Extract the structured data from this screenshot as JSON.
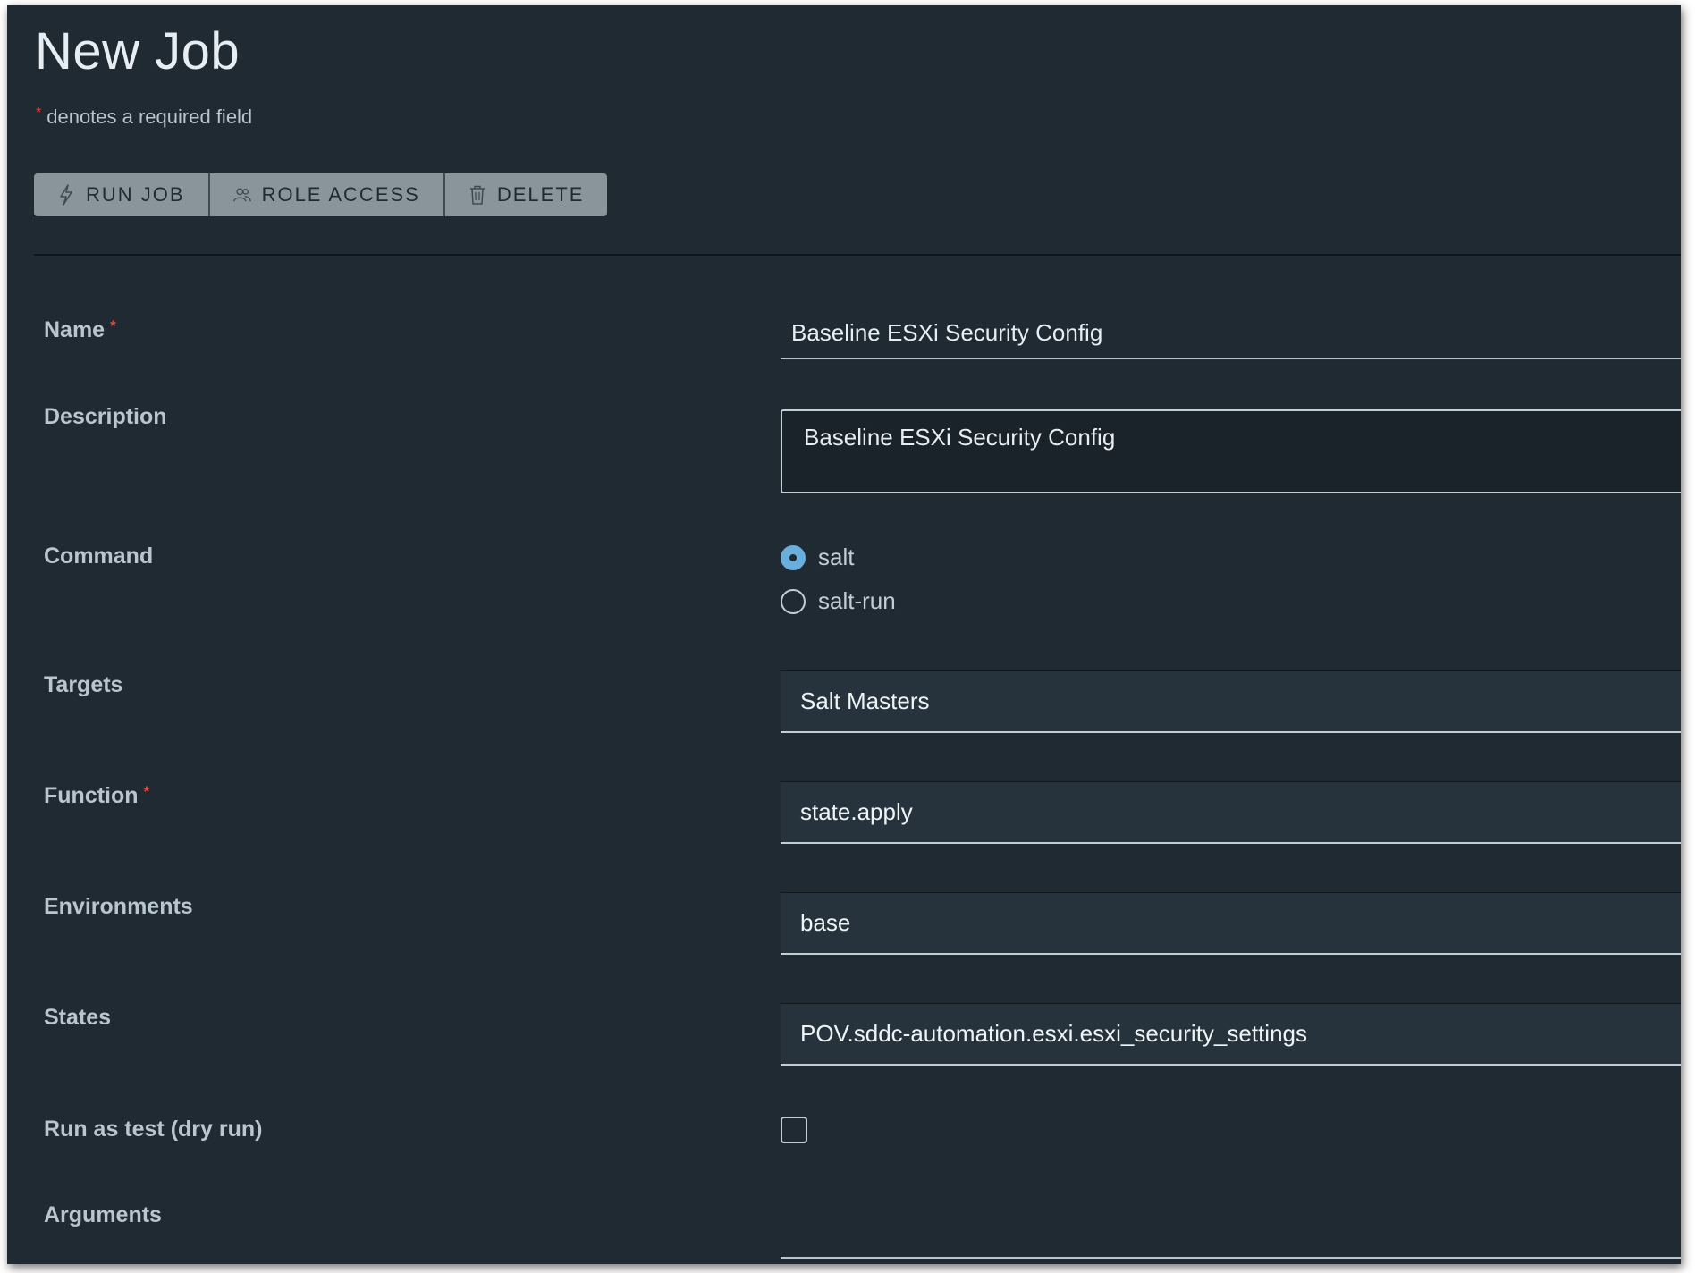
{
  "page": {
    "title": "New Job",
    "required_note": "denotes a required field",
    "required_marker": "*"
  },
  "toolbar": {
    "run_job": {
      "label": "RUN JOB",
      "icon": "bolt-icon"
    },
    "role_access": {
      "label": "ROLE ACCESS",
      "icon": "users-icon"
    },
    "delete": {
      "label": "DELETE",
      "icon": "trash-icon"
    }
  },
  "form": {
    "name": {
      "label": "Name",
      "value": "Baseline ESXi Security Config",
      "required": true
    },
    "description": {
      "label": "Description",
      "value": "Baseline ESXi Security Config"
    },
    "command": {
      "label": "Command",
      "options": [
        {
          "label": "salt",
          "checked": true
        },
        {
          "label": "salt-run",
          "checked": false
        }
      ]
    },
    "targets": {
      "label": "Targets",
      "value": "Salt Masters"
    },
    "function": {
      "label": "Function",
      "value": "state.apply",
      "required": true
    },
    "environments": {
      "label": "Environments",
      "value": "base"
    },
    "states": {
      "label": "States",
      "value": "POV.sddc-automation.esxi.esxi_security_settings"
    },
    "dry_run": {
      "label": "Run as test (dry run)",
      "checked": false
    },
    "arguments": {
      "label": "Arguments",
      "value": ""
    }
  },
  "colors": {
    "background": "#1f2a33",
    "accent": "#6aaedc",
    "required": "#e6473f",
    "button": "#8a959b"
  }
}
